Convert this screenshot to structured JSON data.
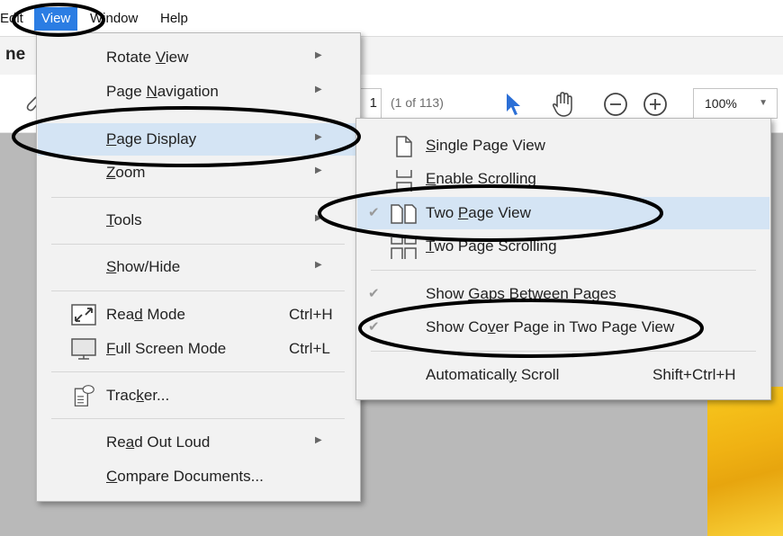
{
  "menubar": {
    "items": [
      {
        "label": "Edit"
      },
      {
        "label": "View"
      },
      {
        "label": "Window"
      },
      {
        "label": "Help"
      }
    ]
  },
  "document": {
    "tab_title": "ne",
    "page_number": "1",
    "page_count": "(1 of 113)",
    "zoom": "100%"
  },
  "toolbar": {
    "icons": [
      "cursor-icon",
      "hand-icon",
      "zoom-out-icon",
      "zoom-in-icon"
    ]
  },
  "view_menu": {
    "items": [
      {
        "pre": "Rotate ",
        "u": "V",
        "post": "iew",
        "submenu": true
      },
      {
        "pre": "Page ",
        "u": "N",
        "post": "avigation",
        "submenu": true
      },
      {
        "pre": "",
        "u": "P",
        "post": "age Display",
        "submenu": true,
        "highlighted": true
      },
      {
        "pre": "",
        "u": "Z",
        "post": "oom",
        "submenu": true
      },
      {
        "pre": "",
        "u": "T",
        "post": "ools",
        "submenu": true
      },
      {
        "pre": "",
        "u": "S",
        "post": "how/Hide",
        "submenu": true
      },
      {
        "pre": "Rea",
        "u": "d",
        "post": " Mode",
        "shortcut": "Ctrl+H",
        "icon": "read-mode-icon"
      },
      {
        "pre": "",
        "u": "F",
        "post": "ull Screen Mode",
        "shortcut": "Ctrl+L",
        "icon": "full-screen-icon"
      },
      {
        "pre": "Trac",
        "u": "k",
        "post": "er...",
        "icon": "tracker-icon"
      },
      {
        "pre": "Re",
        "u": "a",
        "post": "d Out Loud",
        "submenu": true
      },
      {
        "pre": "",
        "u": "C",
        "post": "ompare Documents..."
      }
    ]
  },
  "page_display_submenu": {
    "items": [
      {
        "pre": "",
        "u": "S",
        "post": "ingle Page View",
        "icon": "single-page-icon"
      },
      {
        "pre": "",
        "u": "E",
        "post": "nable Scrolling",
        "icon": "enable-scrolling-icon"
      },
      {
        "pre": "Two ",
        "u": "P",
        "post": "age View",
        "icon": "two-page-icon",
        "checked": true,
        "highlighted": true
      },
      {
        "pre": "",
        "u": "T",
        "post": "wo Page Scrolling",
        "icon": "two-page-scrolling-icon"
      },
      {
        "pre": "Show ",
        "u": "G",
        "post": "aps Between Pages",
        "checked": true
      },
      {
        "pre": "Show Co",
        "u": "v",
        "post": "er Page in Two Page View",
        "checked": true
      },
      {
        "pre": "Automaticall",
        "u": "y",
        "post": " Scroll",
        "shortcut": "Shift+Ctrl+H"
      }
    ]
  },
  "colors": {
    "menu_bg": "#f2f2f2",
    "highlight": "#d4e4f4",
    "accent": "#2b7de3",
    "document_bg": "#b9b9b9"
  }
}
